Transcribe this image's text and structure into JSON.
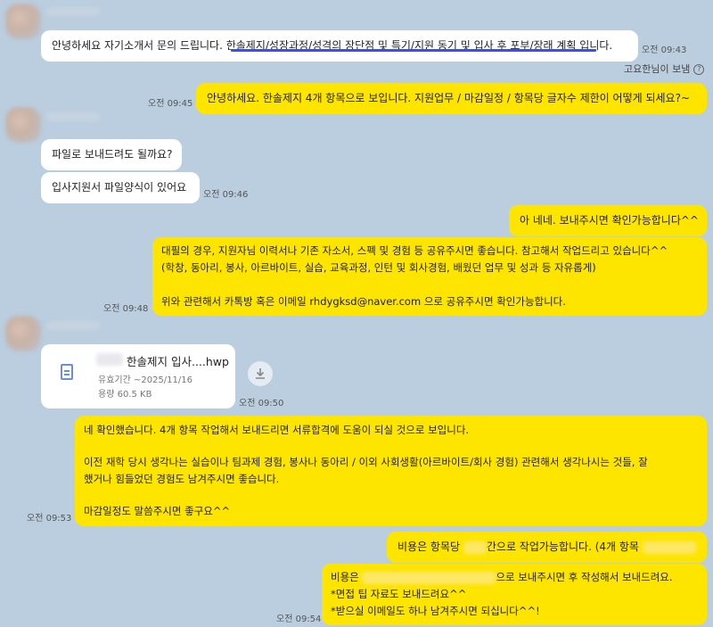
{
  "messages": {
    "m1": {
      "text_before": "안녕하세요 자기소개서 문의 드립니다. ",
      "text_highlight": "한솔제지/성장과정/성격의 장단점 및 특기/지원 동기 및 입사 후 포부/장래 계획",
      "text_after": " 입니다.",
      "time": "오전 09:43"
    },
    "read_receipt": "고요한님이 보냄",
    "m2": {
      "text": "안녕하세요. 한솔제지 4개 항목으로 보입니다. 지원업무 / 마감일정 / 항목당 글자수 제한이 어떻게 되세요?~",
      "time": "오전 09:45"
    },
    "m3": {
      "text": "파일로 보내드려도 될까요?"
    },
    "m4": {
      "text": "입사지원서 파일양식이 있어요",
      "time": "오전 09:46"
    },
    "m5": {
      "text": "아 네네. 보내주시면 확인가능합니다^^"
    },
    "m6": {
      "lines": [
        "대필의 경우, 지원자님 이력서나 기존 자소서, 스펙 및 경험 등 공유주시면 좋습니다. 참고해서 작업드리고 있습니다^^",
        "(학창, 동아리, 봉사, 아르바이트, 실습, 교육과정, 인턴 및 회사경험, 배웠던 업무 및 성과 등 자유롭게)",
        "",
        "위와 관련해서 카톡방 혹은 이메일 rhdygksd@naver.com 으로 공유주시면 확인가능합니다."
      ],
      "time": "오전 09:48"
    },
    "file": {
      "name": "한솔제지 입사....hwp",
      "expiry": "유효기간 ~2025/11/16",
      "size": "용량 60.5 KB",
      "time": "오전 09:50"
    },
    "m7": {
      "lines": [
        "네 확인했습니다. 4개 항목 작업해서 보내드리면 서류합격에 도움이 되실 것으로 보입니다.",
        "",
        "이전 재학 당시 생각나는 실습이나 팀과제 경험, 봉사나 동아리 / 이외 사회생활(아르바이트/회사 경험) 관련해서 생각나시는 것들, 잘",
        "했거나 힘들었던 경험도 남겨주시면 좋습니다.",
        "",
        "마감일정도 말씀주시면 좋구요^^"
      ],
      "time": "오전 09:53"
    },
    "m8": {
      "text_before": "비용은 항목당 ",
      "text_after": "간으로 작업가능합니다. (4개 항목"
    },
    "m9": {
      "line1_before": "비용은 ",
      "line1_after": "으로 보내주시면 후 작성해서 보내드려요.",
      "line2": "*면접 팁 자료도 보내드려요^^",
      "line3": "*받으실 이메일도 하나 남겨주시면 되십니다^^!",
      "time": "오전 09:54"
    }
  },
  "icons": {
    "download": "download-icon",
    "file": "file-icon",
    "question": "question-icon"
  },
  "colors": {
    "background": "#bacee0",
    "my_bubble": "#fee500",
    "their_bubble": "#ffffff",
    "highlight_underline": "#3f4fe0"
  }
}
